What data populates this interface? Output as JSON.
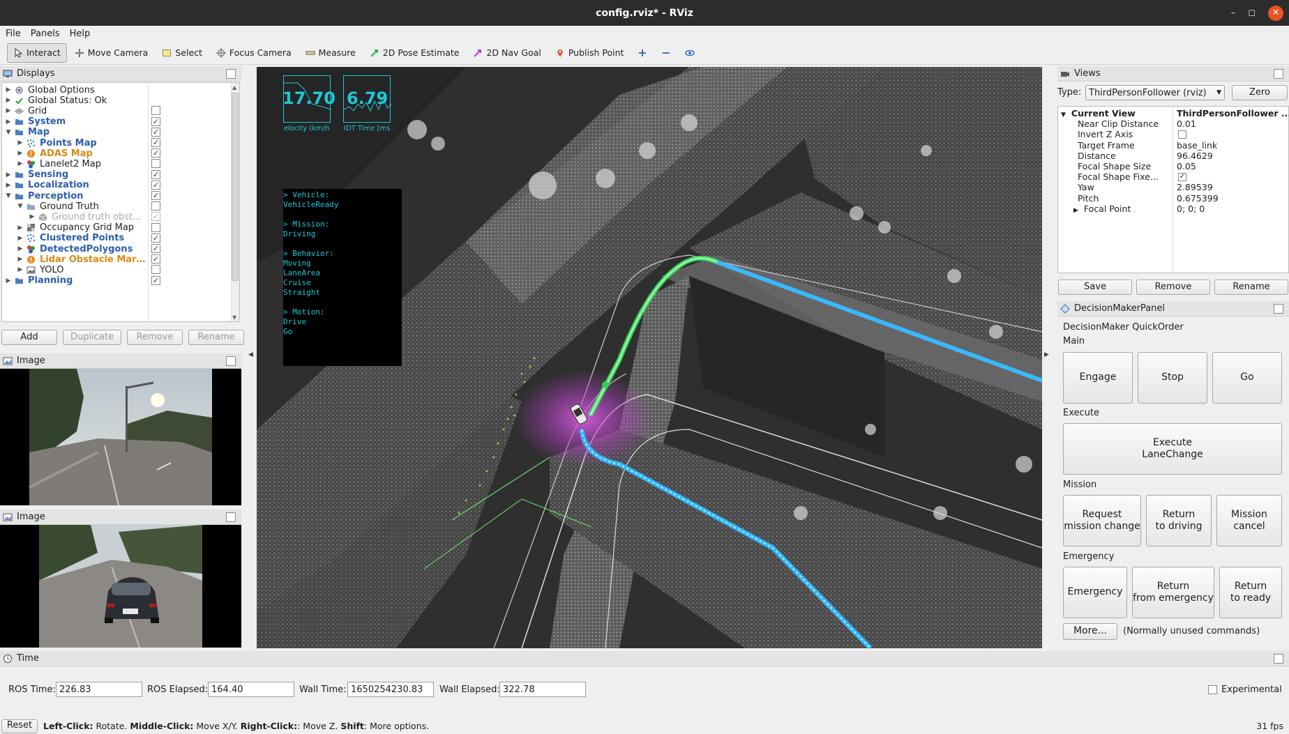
{
  "window": {
    "title": "config.rviz* - RViz",
    "minimize": "–",
    "restore": "◻",
    "close": "✕"
  },
  "menu": [
    "File",
    "Panels",
    "Help"
  ],
  "toolbar": {
    "interact": "Interact",
    "move_camera": "Move Camera",
    "select": "Select",
    "focus_camera": "Focus Camera",
    "measure": "Measure",
    "pose_estimate": "2D Pose Estimate",
    "nav_goal": "2D Nav Goal",
    "publish_point": "Publish Point"
  },
  "displays": {
    "title": "Displays",
    "items": [
      {
        "label": "Global Options",
        "level": 0,
        "expander": "right",
        "icon": "gear",
        "style": "normal"
      },
      {
        "label": "Global Status: Ok",
        "level": 0,
        "expander": "right",
        "icon": "check",
        "style": "normal"
      },
      {
        "label": "Grid",
        "level": 0,
        "expander": "right",
        "icon": "grid",
        "style": "normal",
        "checked": false
      },
      {
        "label": "System",
        "level": 0,
        "expander": "right",
        "icon": "folder",
        "style": "blue",
        "checked": true
      },
      {
        "label": "Map",
        "level": 0,
        "expander": "down",
        "icon": "folder",
        "style": "blue",
        "checked": true
      },
      {
        "label": "Points Map",
        "level": 1,
        "expander": "right",
        "icon": "points",
        "style": "blue",
        "checked": true
      },
      {
        "label": "ADAS Map",
        "level": 1,
        "expander": "right",
        "icon": "warning",
        "style": "orange",
        "checked": true
      },
      {
        "label": "Lanelet2 Map",
        "level": 1,
        "expander": "right",
        "icon": "marker",
        "style": "normal",
        "checked": false
      },
      {
        "label": "Sensing",
        "level": 0,
        "expander": "right",
        "icon": "folder",
        "style": "blue",
        "checked": true
      },
      {
        "label": "Localization",
        "level": 0,
        "expander": "right",
        "icon": "folder",
        "style": "blue",
        "checked": true
      },
      {
        "label": "Perception",
        "level": 0,
        "expander": "down",
        "icon": "folder",
        "style": "blue",
        "checked": true
      },
      {
        "label": "Ground Truth",
        "level": 1,
        "expander": "down",
        "icon": "folder-grey",
        "style": "normal",
        "checked": false
      },
      {
        "label": "Ground truth obst…",
        "level": 2,
        "expander": "right",
        "icon": "cube",
        "style": "grey",
        "checked": true,
        "disabled": true
      },
      {
        "label": "Occupancy Grid Map",
        "level": 1,
        "expander": "right",
        "icon": "map",
        "style": "normal",
        "checked": false
      },
      {
        "label": "Clustered Points",
        "level": 1,
        "expander": "right",
        "icon": "points",
        "style": "blue",
        "checked": true
      },
      {
        "label": "DetectedPolygons",
        "level": 1,
        "expander": "right",
        "icon": "marker",
        "style": "blue",
        "checked": true
      },
      {
        "label": "Lidar Obstacle Mar…",
        "level": 1,
        "expander": "right",
        "icon": "warning",
        "style": "orange",
        "checked": true
      },
      {
        "label": "YOLO",
        "level": 1,
        "expander": "right",
        "icon": "image",
        "style": "normal",
        "checked": false
      },
      {
        "label": "Planning",
        "level": 0,
        "expander": "right",
        "icon": "folder",
        "style": "blue",
        "checked": true
      }
    ],
    "buttons": {
      "add": "Add",
      "duplicate": "Duplicate",
      "remove": "Remove",
      "rename": "Rename"
    }
  },
  "image_panels": [
    {
      "title": "Image"
    },
    {
      "title": "Image"
    }
  ],
  "hud": {
    "velocity_value": "17.70",
    "velocity_label": "elocity (km/h",
    "ndt_value": "6.79",
    "ndt_label": "IDT Time [ms",
    "status_lines": [
      "> Vehicle:",
      "VehicleReady",
      "",
      "> Mission:",
      "Driving",
      "",
      "> Behavior:",
      "Moving",
      "LaneArea",
      "Cruise",
      "Straight",
      "",
      "> Motion:",
      "Drive",
      "Go"
    ]
  },
  "views": {
    "title": "Views",
    "type_label": "Type:",
    "type_value": "ThirdPersonFollower (rviz)",
    "zero": "Zero",
    "properties": [
      {
        "name": "Current View",
        "value": "ThirdPersonFollower ...",
        "bold": true,
        "expander": "down"
      },
      {
        "name": "Near Clip Distance",
        "value": "0.01"
      },
      {
        "name": "Invert Z Axis",
        "checkbox": false
      },
      {
        "name": "Target Frame",
        "value": "base_link"
      },
      {
        "name": "Distance",
        "value": "96.4629"
      },
      {
        "name": "Focal Shape Size",
        "value": "0.05"
      },
      {
        "name": "Focal Shape Fixe...",
        "checkbox": true
      },
      {
        "name": "Yaw",
        "value": "2.89539"
      },
      {
        "name": "Pitch",
        "value": "0.675399"
      },
      {
        "name": "Focal Point",
        "value": "0; 0; 0",
        "expander": "right"
      }
    ],
    "buttons": {
      "save": "Save",
      "remove": "Remove",
      "rename": "Rename"
    }
  },
  "decision_maker": {
    "title": "DecisionMakerPanel",
    "heading": "DecisionMaker QuickOrder",
    "main_label": "Main",
    "main_buttons": [
      "Engage",
      "Stop",
      "Go"
    ],
    "execute_label": "Execute",
    "execute_button": "Execute\nLaneChange",
    "mission_label": "Mission",
    "mission_buttons": [
      "Request\nmission change",
      "Return\nto driving",
      "Mission\ncancel"
    ],
    "emergency_label": "Emergency",
    "emergency_buttons": [
      "Emergency",
      "Return\nfrom emergency",
      "Return\nto ready"
    ],
    "more": "More...",
    "more_note": "(Normally unused commands)"
  },
  "time": {
    "title": "Time",
    "ros_time_label": "ROS Time:",
    "ros_time": "226.83",
    "ros_elapsed_label": "ROS Elapsed:",
    "ros_elapsed": "164.40",
    "wall_time_label": "Wall Time:",
    "wall_time": "1650254230.83",
    "wall_elapsed_label": "Wall Elapsed:",
    "wall_elapsed": "322.78",
    "experimental": "Experimental"
  },
  "statusbar": {
    "reset": "Reset",
    "left_click": "Left-Click:",
    "left_desc": " Rotate. ",
    "middle_click": "Middle-Click:",
    "middle_desc": " Move X/Y. ",
    "right_click": "Right-Click:",
    "right_desc": ": Move Z. ",
    "shift": "Shift",
    "shift_desc": ": More options.",
    "fps": "31 fps"
  },
  "colors": {
    "accent_blue": "#2a5db0",
    "accent_orange": "#d98a14",
    "hud_cyan": "#1ec8d8",
    "close_button": "#e95420"
  }
}
